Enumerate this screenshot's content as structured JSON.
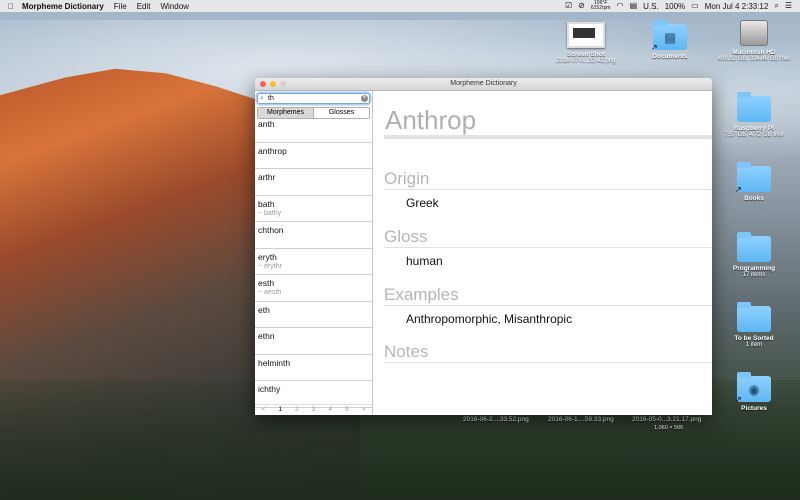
{
  "menubar": {
    "app_name": "Morpheme Dictionary",
    "menus": [
      "File",
      "Edit",
      "Window"
    ],
    "temp": "106°F",
    "rpm": "6152rpm",
    "input_source": "U.S.",
    "battery": "100%",
    "datetime": "Mon Jul 4  2:33:12"
  },
  "desktop": {
    "icons": [
      {
        "name": "Screen Shot",
        "sub": "2016-07-0...32.42.png"
      },
      {
        "name": "Documents",
        "sub": ""
      },
      {
        "name": "Macintosh HD",
        "sub": "499.82 GB, 334.46 GB free"
      },
      {
        "name": "Raspberry Pi",
        "sub": "7.57 GB, 4.72 GB free"
      },
      {
        "name": "Books",
        "sub": ""
      },
      {
        "name": "Programming",
        "sub": "17 items"
      },
      {
        "name": "To be Sorted",
        "sub": "1 item"
      },
      {
        "name": "Pictures",
        "sub": ""
      }
    ],
    "files": [
      "2016-06-2....33.52.png",
      "2016-06-1....59.33.png",
      "2016-05-0...3.21.17.png"
    ],
    "file_sub": "1,060 × 506"
  },
  "window": {
    "title": "Morpheme Dictionary",
    "search_value": "th",
    "tabs": [
      "Morphemes",
      "Glosses"
    ],
    "list": [
      {
        "term": "anth",
        "alt": ""
      },
      {
        "term": "anthrop",
        "alt": ""
      },
      {
        "term": "arthr",
        "alt": ""
      },
      {
        "term": "bath",
        "alt": "~ bathy"
      },
      {
        "term": "chthon",
        "alt": ""
      },
      {
        "term": "eryth",
        "alt": "~ erythr"
      },
      {
        "term": "esth",
        "alt": "~ aesth"
      },
      {
        "term": "eth",
        "alt": ""
      },
      {
        "term": "ethn",
        "alt": ""
      },
      {
        "term": "helminth",
        "alt": ""
      },
      {
        "term": "ichthy",
        "alt": ""
      }
    ],
    "pager": [
      "<",
      "1",
      "2",
      "3",
      "4",
      "5",
      ">"
    ],
    "detail": {
      "term": "Anthrop",
      "origin_heading": "Origin",
      "origin": "Greek",
      "gloss_heading": "Gloss",
      "gloss": "human",
      "examples_heading": "Examples",
      "examples": "Anthropomorphic, Misanthropic",
      "notes_heading": "Notes",
      "notes": ""
    }
  }
}
